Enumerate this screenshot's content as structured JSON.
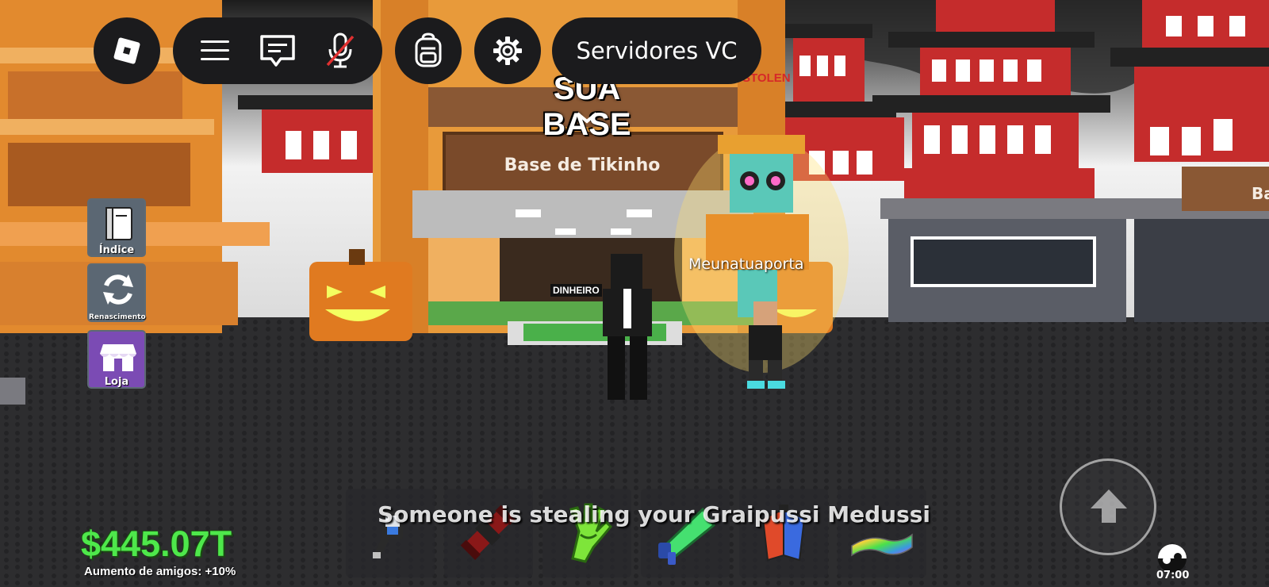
{
  "topbar": {
    "roblox_menu_icon": "roblox-logo-icon",
    "hamburger_icon": "hamburger-menu-icon",
    "chat_icon": "chat-icon",
    "mic_icon": "microphone-muted-icon",
    "backpack_icon": "backpack-icon",
    "settings_icon": "gear-icon",
    "voice_servers_label": "Servidores VC"
  },
  "world": {
    "base_title": "SUA BASE",
    "base_sign": "Base de Tikinho",
    "stolen_tag": "STOLEN",
    "side_sign_fragment": "Ba",
    "player_name": "Meunatuaporta",
    "floating_tag": "DINHEIRO"
  },
  "side_menu": [
    {
      "label": "Índice",
      "icon": "book-icon",
      "color": "#5b6773"
    },
    {
      "label": "Renascimento",
      "icon": "refresh-icon",
      "color": "#5b6773"
    },
    {
      "label": "Loja",
      "icon": "shop-icon",
      "color": "#7b4bb4"
    }
  ],
  "hotbar": {
    "notification": "Someone is stealing your Graipussi Medussi",
    "slots": [
      {
        "item": "grapple-hook-icon"
      },
      {
        "item": "rocket-launcher-icon"
      },
      {
        "item": "slime-glove-icon"
      },
      {
        "item": "megaphone-icon"
      },
      {
        "item": "rainbow-cape-icon"
      },
      {
        "item": "flying-carpet-icon"
      }
    ]
  },
  "status": {
    "money": "$445.07T",
    "friends_boost": "Aumento de amigos: +10%",
    "clock": "07:00"
  },
  "controls": {
    "jump_icon": "jump-arrow-icon"
  }
}
